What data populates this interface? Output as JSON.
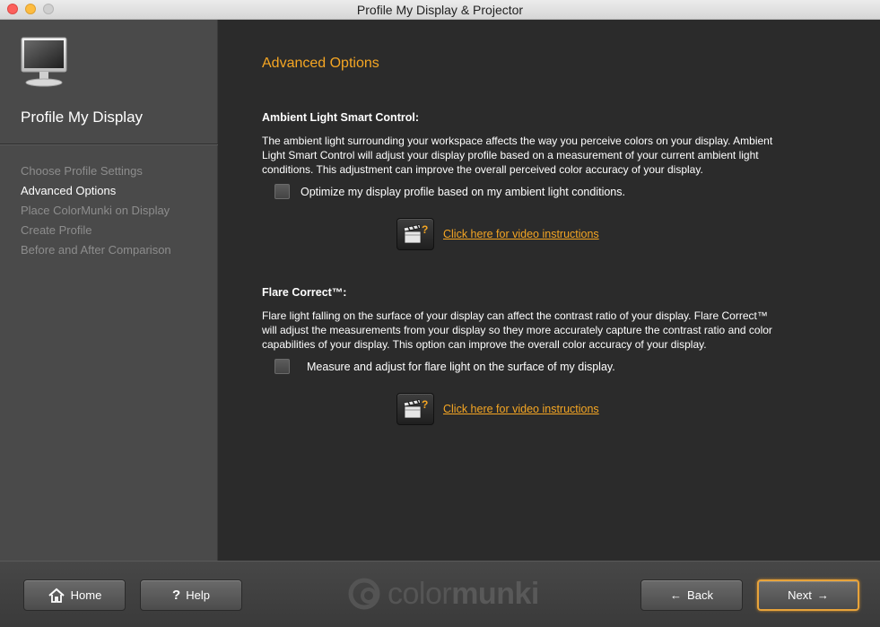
{
  "window": {
    "title": "Profile My Display & Projector"
  },
  "sidebar": {
    "title": "Profile My Display",
    "steps": [
      {
        "label": "Choose Profile Settings",
        "active": false
      },
      {
        "label": "Advanced Options",
        "active": true
      },
      {
        "label": "Place ColorMunki on Display",
        "active": false
      },
      {
        "label": "Create Profile",
        "active": false
      },
      {
        "label": "Before and After Comparison",
        "active": false
      }
    ]
  },
  "main": {
    "heading": "Advanced Options",
    "ambient": {
      "title": "Ambient Light Smart Control:",
      "lines": [
        "The ambient light surrounding your workspace affects the way you perceive colors on your display. Ambient",
        "Light Smart Control will adjust your display profile based on a measurement of your current ambient light",
        "conditions.  This adjustment can improve the overall perceived color accuracy of your display."
      ],
      "checkbox_label": "Optimize my display profile based on my ambient light conditions.",
      "checked": false,
      "video_link": "Click here for video instructions"
    },
    "flare": {
      "title": "Flare Correct™:",
      "lines": [
        "Flare light falling on the surface of your display can affect the contrast ratio of your display.  Flare Correct™",
        "will adjust the measurements from your display so they more accurately capture the contrast ratio and color",
        "capabilities of your display.  This option can improve the overall color accuracy of your display."
      ],
      "checkbox_label": "Measure and adjust for flare light on the surface of my display.",
      "checked": false,
      "video_link": "Click here for video instructions"
    }
  },
  "footer": {
    "home_label": "Home",
    "help_label": "Help",
    "back_label": "Back",
    "next_label": "Next",
    "brand": {
      "part1": "color",
      "part2": "munki"
    }
  },
  "colors": {
    "accent": "#f5a623",
    "sidebar_bg": "#4a4a4a",
    "main_bg": "#2b2b2b"
  }
}
